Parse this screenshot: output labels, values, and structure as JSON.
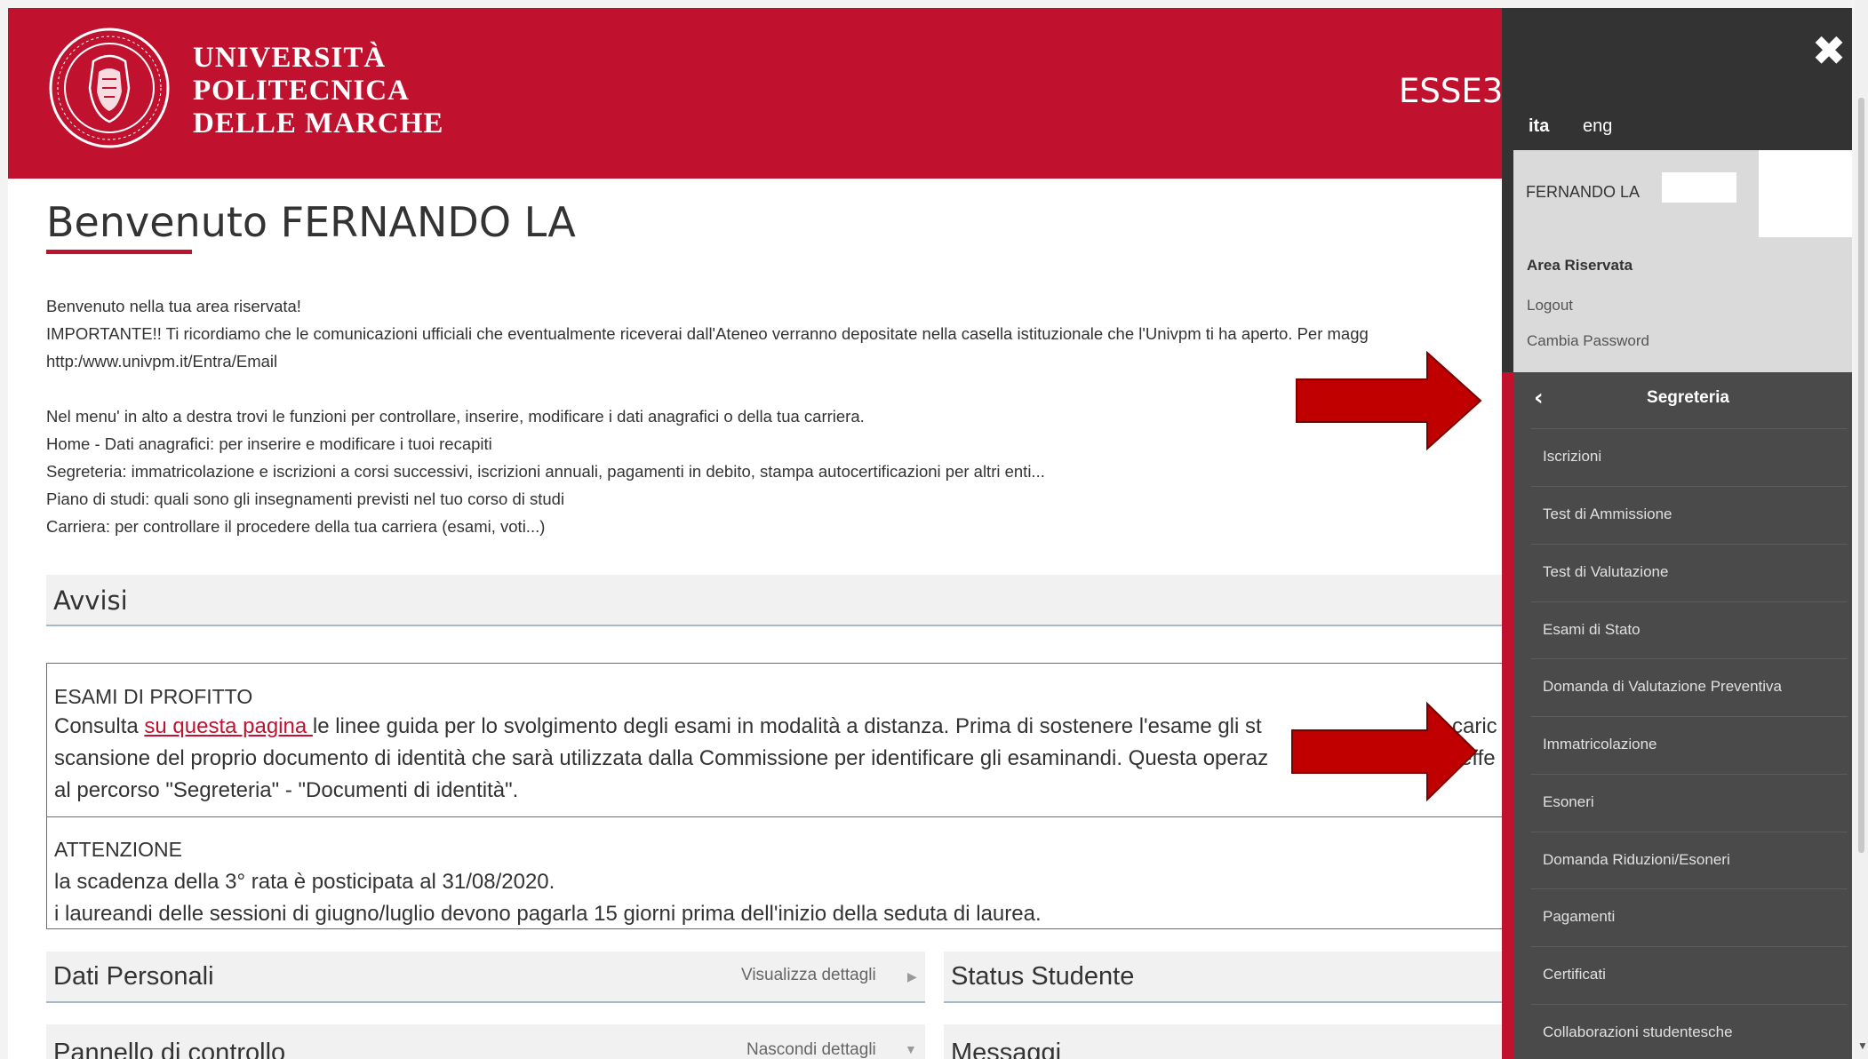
{
  "header": {
    "university_lines": [
      "UNIVERSITÀ",
      "POLITECNICA",
      "DELLE MARCHE"
    ],
    "system_name": "ESSE3",
    "accent_color": "#c0122f"
  },
  "main": {
    "welcome_title": "Benvenuto FERNANDO LA",
    "intro_lines": [
      "Benvenuto nella tua area riservata!",
      "IMPORTANTE!! Ti ricordiamo che le comunicazioni ufficiali che eventualmente riceverai dall'Ateneo verranno depositate nella casella istituzionale che l'Univpm ti ha aperto. Per magg",
      "http:/www.univpm.it/Entra/Email",
      "Nel menu' in alto a destra trovi le funzioni per controllare, inserire, modificare i dati anagrafici o della tua carriera.",
      "Home - Dati anagrafici: per inserire e modificare i tuoi recapiti",
      "Segreteria: immatricolazione e iscrizioni a corsi successivi, iscrizioni annuali, pagamenti in debito, stampa autocertificazioni per altri enti...",
      "Piano di studi: quali sono gli insegnamenti previsti nel tuo corso di studi",
      "Carriera: per controllare il procedere della tua carriera (esami, voti...)"
    ],
    "avvisi": {
      "title": "Avvisi",
      "notice1_title": "ESAMI DI PROFITTO",
      "notice1_line1_pre": "Consulta ",
      "notice1_link": "su questa pagina ",
      "notice1_line1_post": "le linee guida per lo svolgimento degli esami in modalità a distanza. Prima di sostenere l'esame gli st",
      "notice1_line1_tail": "caric",
      "notice1_line2": "scansione del proprio documento di identità che sarà utilizzata dalla Commissione per identificare gli esaminandi. Questa operaz",
      "notice1_line2_tail": "effe",
      "notice1_line3": "al percorso \"Segreteria\" - \"Documenti di identità\".",
      "notice2_title": "ATTENZIONE",
      "notice2_line1": "la scadenza della 3° rata è posticipata al 31/08/2020.",
      "notice2_line2": "i laureandi delle sessioni di giugno/luglio devono pagarla 15 giorni prima dell'inizio della seduta di laurea."
    },
    "panels": {
      "dati_personali": {
        "title": "Dati Personali",
        "action": "Visualizza dettagli"
      },
      "status_studente": {
        "title": "Status Studente"
      },
      "pannello_controllo": {
        "title": "Pannello di controllo",
        "action": "Nascondi dettagli"
      },
      "messaggi": {
        "title": "Messaggi"
      }
    }
  },
  "sidemenu": {
    "close_icon": "close-icon",
    "languages": [
      "ita",
      "eng"
    ],
    "active_language": "ita",
    "user_name": "FERNANDO LA",
    "area_label": "Area Riservata",
    "logout": "Logout",
    "change_password": "Cambia Password",
    "section_title": "Segreteria",
    "back_icon": "chevron-left-icon",
    "items": [
      "Iscrizioni",
      "Test di Ammissione",
      "Test di Valutazione",
      "Esami di Stato",
      "Domanda di Valutazione Preventiva",
      "Immatricolazione",
      "Esoneri",
      "Domanda Riduzioni/Esoneri",
      "Pagamenti",
      "Certificati",
      "Collaborazioni studentesche"
    ]
  },
  "annotations": {
    "arrow_color": "#c00000",
    "arrow_targets": [
      "Segreteria",
      "Immatricolazione"
    ]
  }
}
